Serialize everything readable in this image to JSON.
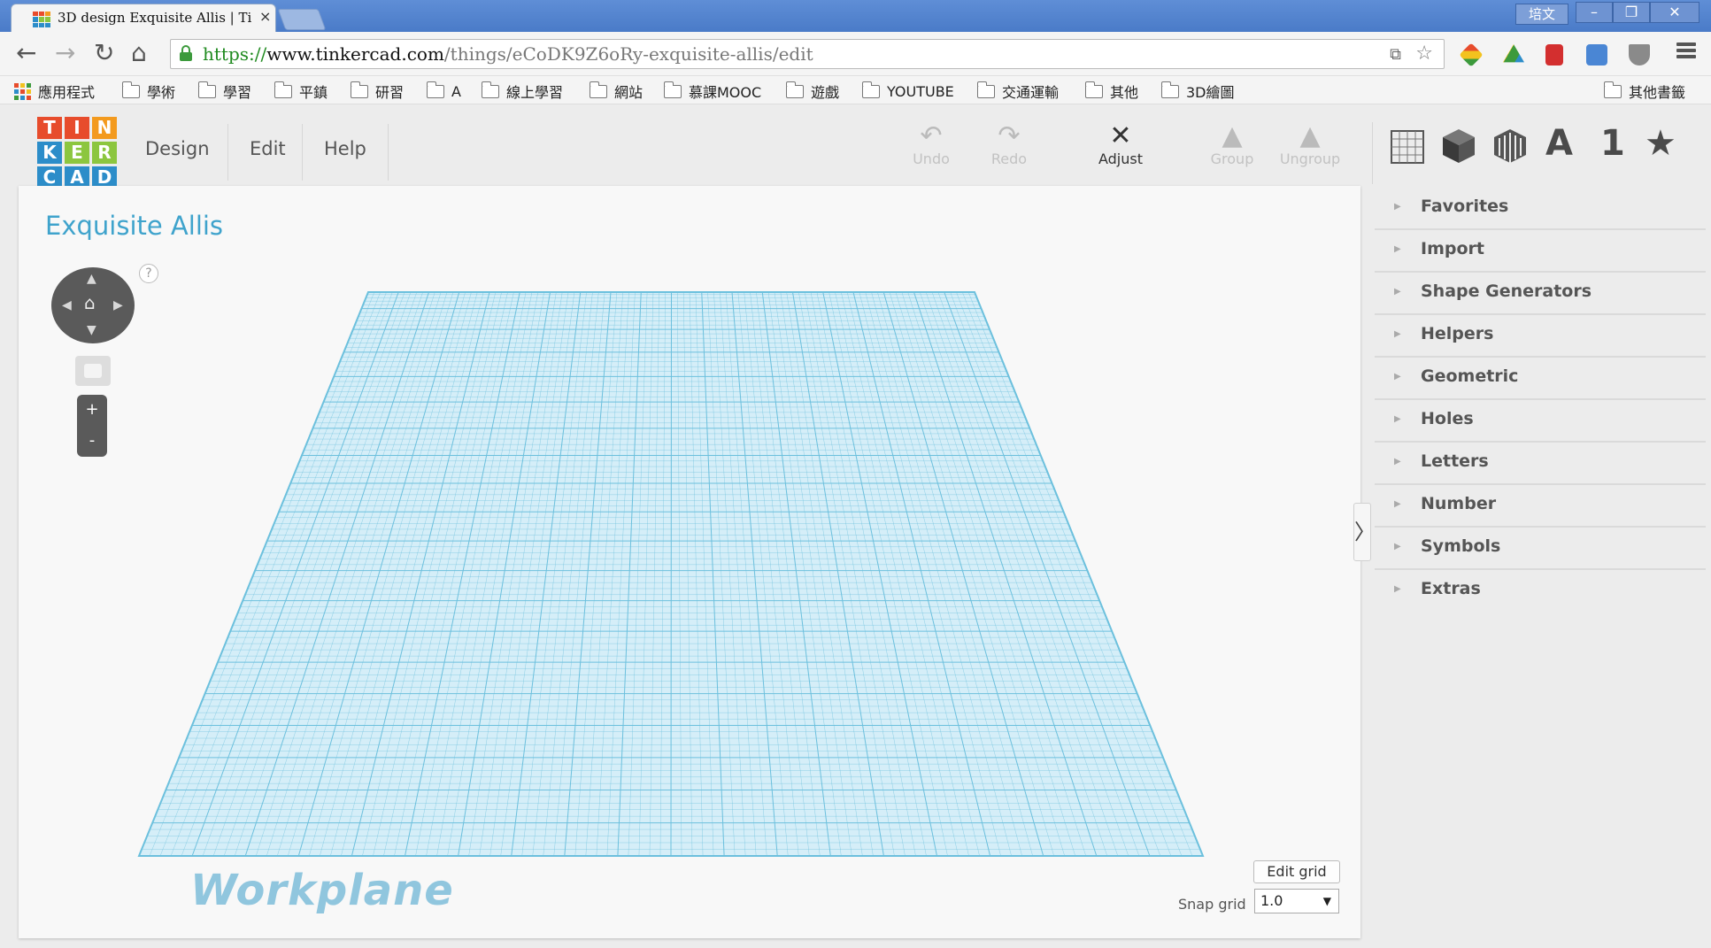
{
  "browser": {
    "tab_title": "3D design Exquisite Allis | Ti",
    "close": "×",
    "user_label": "培文",
    "min": "–",
    "restore": "❐",
    "win_close": "✕",
    "back": "←",
    "forward": "→",
    "reload": "↻",
    "home": "⌂",
    "url_scheme": "https://",
    "url_host": "www.tinkercad.com",
    "url_path": "/things/eCoDK9Z6oRy-exquisite-allis/edit",
    "translate": "⧉",
    "star": "☆"
  },
  "bookmarks": {
    "apps": "應用程式",
    "items": [
      "學術",
      "學習",
      "平鎮",
      "研習",
      "A",
      "線上學習",
      "網站",
      "慕課MOOC",
      "遊戲",
      "YOUTUBE",
      "交通運輸",
      "其他",
      "3D繪圖"
    ],
    "other": "其他書籤"
  },
  "app": {
    "logo": [
      "T",
      "I",
      "N",
      "K",
      "E",
      "R",
      "C",
      "A",
      "D"
    ],
    "logo_colors": [
      "#e74c2c",
      "#e74c2c",
      "#f39a1e",
      "#2c8dc9",
      "#8cc63f",
      "#8cc63f",
      "#2c8dc9",
      "#2c8dc9",
      "#2c8dc9"
    ],
    "menu": [
      "Design",
      "Edit",
      "Help"
    ],
    "tools": {
      "undo": "Undo",
      "redo": "Redo",
      "adjust": "Adjust",
      "group": "Group",
      "ungroup": "Ungroup"
    },
    "tool_icons": {
      "undo": "↶",
      "redo": "↷",
      "adjust": "✕",
      "group": "▲",
      "ungroup": "▲"
    },
    "right_icons": [
      "workplane-icon",
      "box-icon",
      "shape-icon",
      "A",
      "1",
      "★"
    ],
    "design_title": "Exquisite Allis",
    "help": "?",
    "zoom_in": "+",
    "zoom_out": "-",
    "workplane_label": "Workplane",
    "edit_grid": "Edit grid",
    "snap_grid_label": "Snap grid",
    "snap_grid_value": "1.0",
    "panel_toggle": "〉",
    "panel_items": [
      "Favorites",
      "Import",
      "Shape Generators",
      "Helpers",
      "Geometric",
      "Holes",
      "Letters",
      "Number",
      "Symbols",
      "Extras"
    ],
    "grid_color": "#6cc0dd",
    "accent": "#3fa3cc"
  }
}
